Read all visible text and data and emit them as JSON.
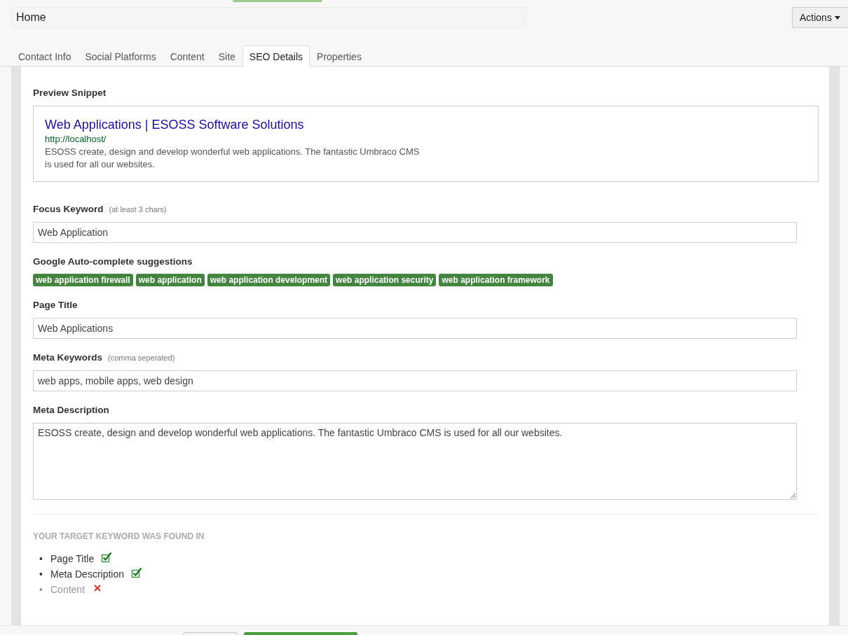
{
  "header": {
    "name": "Home",
    "actions_button": "Actions"
  },
  "tabs": [
    {
      "label": "Contact Info",
      "selected": false
    },
    {
      "label": "Social Platforms",
      "selected": false
    },
    {
      "label": "Content",
      "selected": false
    },
    {
      "label": "Site",
      "selected": false
    },
    {
      "label": "SEO Details",
      "selected": true
    },
    {
      "label": "Properties",
      "selected": false
    }
  ],
  "preview": {
    "label": "Preview Snippet",
    "title": "Web Applications | ESOSS Software Solutions",
    "url": "http://localhost/",
    "description": "ESOSS create, design and develop wonderful web applications. The fantastic Umbraco CMS is used for all our websites."
  },
  "focus_keyword": {
    "label": "Focus Keyword",
    "hint": "(at least 3 chars)",
    "value": "Web Application"
  },
  "suggestions": {
    "label": "Google Auto-complete suggestions",
    "tags": [
      "web application firewall",
      "web application",
      "web application development",
      "web application security",
      "web application framework"
    ]
  },
  "page_title": {
    "label": "Page Title",
    "value": "Web Applications"
  },
  "meta_keywords": {
    "label": "Meta Keywords",
    "hint": "(comma seperated)",
    "value": "web apps, mobile apps, web design"
  },
  "meta_description": {
    "label": "Meta Description",
    "value": "ESOSS create, design and develop wonderful web applications. The fantastic Umbraco CMS is used for all our websites."
  },
  "keyword_found": {
    "heading": "YOUR TARGET KEYWORD WAS FOUND IN",
    "items": [
      {
        "bullet": "•",
        "label": "Page Title",
        "found": true
      },
      {
        "bullet": "•",
        "label": "Meta Description",
        "found": true
      },
      {
        "bullet": "•",
        "label": "Content",
        "found": false
      }
    ]
  }
}
